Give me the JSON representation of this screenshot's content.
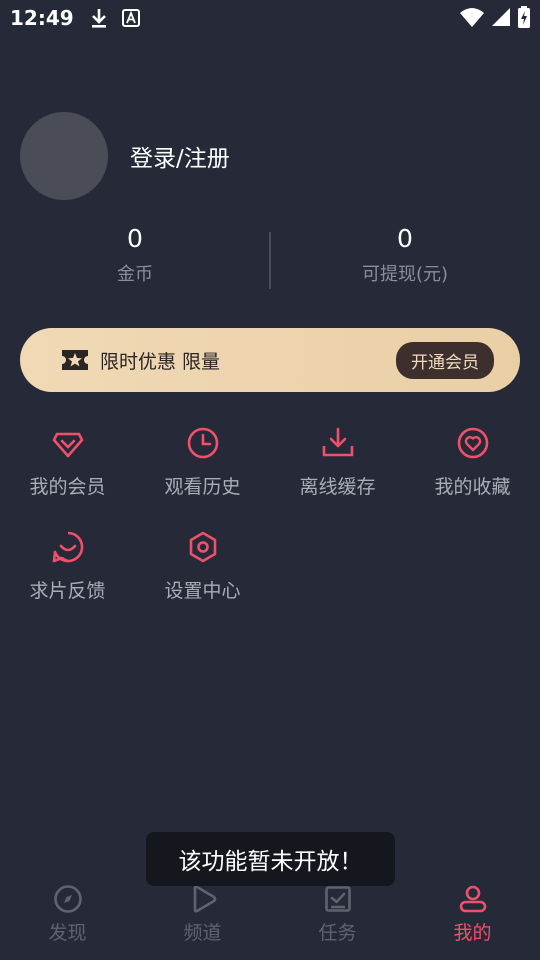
{
  "status_bar": {
    "time": "12:49",
    "left_icons": [
      "download-icon",
      "a-notification-icon"
    ],
    "right_icons": [
      "wifi-icon",
      "signal-icon",
      "battery-charging-icon"
    ]
  },
  "profile": {
    "login_label": "登录/注册"
  },
  "stats": [
    {
      "value": "0",
      "label": "金币"
    },
    {
      "value": "0",
      "label": "可提现(元)"
    }
  ],
  "vip_banner": {
    "text": "限时优惠 限量",
    "button_label": "开通会员",
    "colors": {
      "banner_start": "#f1d9b6",
      "banner_end": "#e9cfa6",
      "button_bg": "#3c2f2d"
    }
  },
  "menu": {
    "items": [
      {
        "label": "我的会员",
        "icon": "diamond-heart-icon"
      },
      {
        "label": "观看历史",
        "icon": "clock-icon"
      },
      {
        "label": "离线缓存",
        "icon": "download-tray-icon"
      },
      {
        "label": "我的收藏",
        "icon": "heart-circle-icon"
      },
      {
        "label": "求片反馈",
        "icon": "smile-chat-icon"
      },
      {
        "label": "设置中心",
        "icon": "hexagon-settings-icon"
      }
    ]
  },
  "toast": {
    "message": "该功能暂未开放！"
  },
  "tabbar": {
    "active_index": 3,
    "accent_color": "#f0506a",
    "tabs": [
      {
        "label": "发现",
        "icon": "compass-icon"
      },
      {
        "label": "频道",
        "icon": "play-icon"
      },
      {
        "label": "任务",
        "icon": "task-check-icon"
      },
      {
        "label": "我的",
        "icon": "person-icon"
      }
    ]
  }
}
